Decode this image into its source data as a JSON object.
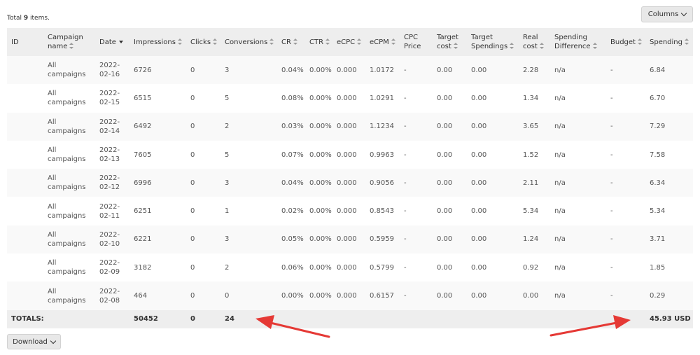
{
  "summary": {
    "prefix": "Total ",
    "count": "9",
    "suffix": " items."
  },
  "toolbar": {
    "columns_label": "Columns",
    "columns_icon": "chevron-down-icon",
    "download_label": "Download",
    "download_icon": "chevron-down-icon"
  },
  "table": {
    "headers": {
      "id": "ID",
      "campaign": "Campaign name",
      "date": "Date",
      "impressions": "Impressions",
      "clicks": "Clicks",
      "conversions": "Conversions",
      "cr": "CR",
      "ctr": "CTR",
      "ecpc": "eCPC",
      "ecpm": "eCPM",
      "cpc_price": "CPC Price",
      "target_cost": "Target cost",
      "target_spendings": "Target Spendings",
      "real_cost": "Real cost",
      "spending_difference": "Spending Difference",
      "budget": "Budget",
      "spending": "Spending"
    },
    "sort": {
      "column": "date",
      "direction": "desc"
    },
    "rows": [
      {
        "id": "",
        "campaign": "All campaigns",
        "date": "2022-02-16",
        "impressions": "6726",
        "clicks": "0",
        "conversions": "3",
        "cr": "0.04%",
        "ctr": "0.00%",
        "ecpc": "0.000",
        "ecpm": "1.0172",
        "cpc_price": "-",
        "target_cost": "0.00",
        "target_spendings": "0.00",
        "real_cost": "2.28",
        "spending_difference": "n/a",
        "budget": "-",
        "spending": "6.84"
      },
      {
        "id": "",
        "campaign": "All campaigns",
        "date": "2022-02-15",
        "impressions": "6515",
        "clicks": "0",
        "conversions": "5",
        "cr": "0.08%",
        "ctr": "0.00%",
        "ecpc": "0.000",
        "ecpm": "1.0291",
        "cpc_price": "-",
        "target_cost": "0.00",
        "target_spendings": "0.00",
        "real_cost": "1.34",
        "spending_difference": "n/a",
        "budget": "-",
        "spending": "6.70"
      },
      {
        "id": "",
        "campaign": "All campaigns",
        "date": "2022-02-14",
        "impressions": "6492",
        "clicks": "0",
        "conversions": "2",
        "cr": "0.03%",
        "ctr": "0.00%",
        "ecpc": "0.000",
        "ecpm": "1.1234",
        "cpc_price": "-",
        "target_cost": "0.00",
        "target_spendings": "0.00",
        "real_cost": "3.65",
        "spending_difference": "n/a",
        "budget": "-",
        "spending": "7.29"
      },
      {
        "id": "",
        "campaign": "All campaigns",
        "date": "2022-02-13",
        "impressions": "7605",
        "clicks": "0",
        "conversions": "5",
        "cr": "0.07%",
        "ctr": "0.00%",
        "ecpc": "0.000",
        "ecpm": "0.9963",
        "cpc_price": "-",
        "target_cost": "0.00",
        "target_spendings": "0.00",
        "real_cost": "1.52",
        "spending_difference": "n/a",
        "budget": "-",
        "spending": "7.58"
      },
      {
        "id": "",
        "campaign": "All campaigns",
        "date": "2022-02-12",
        "impressions": "6996",
        "clicks": "0",
        "conversions": "3",
        "cr": "0.04%",
        "ctr": "0.00%",
        "ecpc": "0.000",
        "ecpm": "0.9056",
        "cpc_price": "-",
        "target_cost": "0.00",
        "target_spendings": "0.00",
        "real_cost": "2.11",
        "spending_difference": "n/a",
        "budget": "-",
        "spending": "6.34"
      },
      {
        "id": "",
        "campaign": "All campaigns",
        "date": "2022-02-11",
        "impressions": "6251",
        "clicks": "0",
        "conversions": "1",
        "cr": "0.02%",
        "ctr": "0.00%",
        "ecpc": "0.000",
        "ecpm": "0.8543",
        "cpc_price": "-",
        "target_cost": "0.00",
        "target_spendings": "0.00",
        "real_cost": "5.34",
        "spending_difference": "n/a",
        "budget": "-",
        "spending": "5.34"
      },
      {
        "id": "",
        "campaign": "All campaigns",
        "date": "2022-02-10",
        "impressions": "6221",
        "clicks": "0",
        "conversions": "3",
        "cr": "0.05%",
        "ctr": "0.00%",
        "ecpc": "0.000",
        "ecpm": "0.5959",
        "cpc_price": "-",
        "target_cost": "0.00",
        "target_spendings": "0.00",
        "real_cost": "1.24",
        "spending_difference": "n/a",
        "budget": "-",
        "spending": "3.71"
      },
      {
        "id": "",
        "campaign": "All campaigns",
        "date": "2022-02-09",
        "impressions": "3182",
        "clicks": "0",
        "conversions": "2",
        "cr": "0.06%",
        "ctr": "0.00%",
        "ecpc": "0.000",
        "ecpm": "0.5799",
        "cpc_price": "-",
        "target_cost": "0.00",
        "target_spendings": "0.00",
        "real_cost": "0.92",
        "spending_difference": "n/a",
        "budget": "-",
        "spending": "1.85"
      },
      {
        "id": "",
        "campaign": "All campaigns",
        "date": "2022-02-08",
        "impressions": "464",
        "clicks": "0",
        "conversions": "0",
        "cr": "0.00%",
        "ctr": "0.00%",
        "ecpc": "0.000",
        "ecpm": "0.6157",
        "cpc_price": "-",
        "target_cost": "0.00",
        "target_spendings": "0.00",
        "real_cost": "0.00",
        "spending_difference": "n/a",
        "budget": "-",
        "spending": "0.29"
      }
    ],
    "totals": {
      "label": "TOTALS:",
      "impressions": "50452",
      "clicks": "0",
      "conversions": "24",
      "spending": "45.93 USD"
    }
  },
  "annotations": {
    "arrow_color": "#e53935"
  },
  "colors": {
    "header_bg": "#eeeeee",
    "row_alt_bg": "#f9f9f9",
    "button_bg": "#e8e8e8"
  }
}
